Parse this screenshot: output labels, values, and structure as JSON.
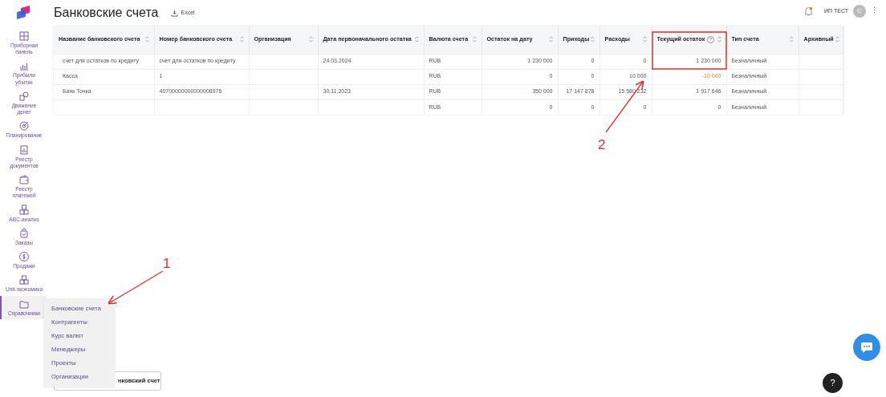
{
  "page": {
    "title": "Банковские счета",
    "export_label": "Excel"
  },
  "header": {
    "user": "ИП ТЕСТ",
    "avatar": "С",
    "more": "⋮"
  },
  "sidebar": {
    "items": [
      {
        "label": "Приборная панель",
        "selected": false
      },
      {
        "label": "Прибыли убытки",
        "selected": false
      },
      {
        "label": "Движение денег",
        "selected": false
      },
      {
        "label": "Планирование",
        "selected": false
      },
      {
        "label": "Реестр документов",
        "selected": false
      },
      {
        "label": "Реестр платежей",
        "selected": false
      },
      {
        "label": "ABC-анализ",
        "selected": false
      },
      {
        "label": "Заказы",
        "selected": false
      },
      {
        "label": "Продажи",
        "selected": false
      },
      {
        "label": "Unit-экономика",
        "selected": false
      },
      {
        "label": "Справочники",
        "selected": true
      }
    ]
  },
  "submenu": {
    "items": [
      "Банковские счета",
      "Контрагенты",
      "Курс валют",
      "Менеджеры",
      "Проекты",
      "Организации"
    ]
  },
  "table": {
    "columns": [
      {
        "label": "Название банковского счета"
      },
      {
        "label": "Номер банковского счета"
      },
      {
        "label": "Организация"
      },
      {
        "label": "Дата первоначального остатка"
      },
      {
        "label": "Валюта счета"
      },
      {
        "label": "Остаток на дату"
      },
      {
        "label": "Приходы"
      },
      {
        "label": "Расходы"
      },
      {
        "label": "Текущий остаток",
        "hint": "?"
      },
      {
        "label": "Тип счета"
      },
      {
        "label": "Архивный"
      }
    ],
    "rows": [
      {
        "cells": [
          "счет для остатков по кредиту",
          "счет для остатков по кредиту",
          "",
          "24.03.2024",
          "RUB",
          "1 230 000",
          "0",
          "0",
          "1 230 000",
          "Безналичный",
          ""
        ],
        "negative": false
      },
      {
        "cells": [
          "Касса",
          "1",
          "",
          "",
          "RUB",
          "0",
          "0",
          "10 000",
          "-10 000",
          "Безналичный",
          ""
        ],
        "negative": true
      },
      {
        "cells": [
          "Банк Точка",
          "40700000000000008976",
          "",
          "30.11.2023",
          "RUB",
          "350 000",
          "17 147 878",
          "15 580 232",
          "1 917 646",
          "Безналичный",
          ""
        ],
        "negative": false
      },
      {
        "cells": [
          "",
          "",
          "",
          "",
          "RUB",
          "0",
          "0",
          "0",
          "0",
          "Безналичный",
          ""
        ],
        "negative": false
      }
    ]
  },
  "add_button": {
    "label": "нковский счет"
  },
  "help_button": "?",
  "annotations": [
    {
      "label": "1"
    },
    {
      "label": "2"
    }
  ]
}
